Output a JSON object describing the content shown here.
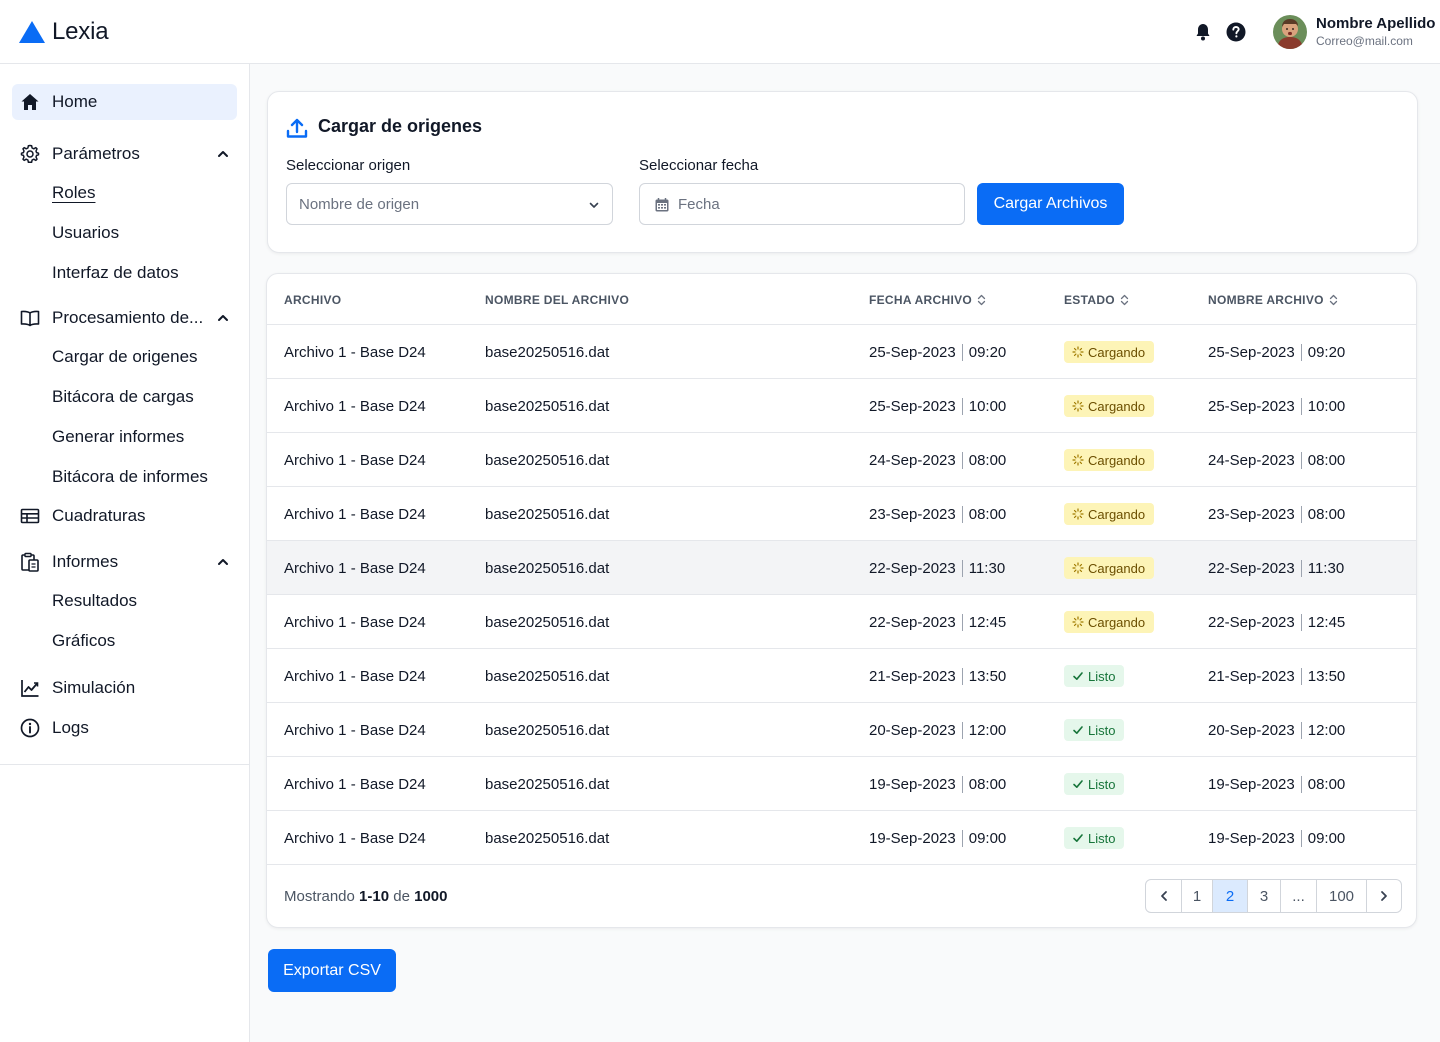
{
  "app": {
    "name": "Lexia"
  },
  "user": {
    "name": "Nombre Apellido",
    "email": "Correo@mail.com"
  },
  "sidebar": {
    "home": "Home",
    "parametros": {
      "label": "Parámetros",
      "children": [
        "Roles",
        "Usuarios",
        "Interfaz de datos"
      ]
    },
    "procesamiento": {
      "label": "Procesamiento de...",
      "children": [
        "Cargar de origenes",
        "Bitácora de cargas",
        "Generar informes",
        "Bitácora de informes"
      ]
    },
    "cuadraturas": "Cuadraturas",
    "informes": {
      "label": "Informes",
      "children": [
        "Resultados",
        "Gráficos"
      ]
    },
    "simulacion": "Simulación",
    "logs": "Logs"
  },
  "upload": {
    "title": "Cargar de origenes",
    "origin_label": "Seleccionar origen",
    "origin_placeholder": "Nombre de origen",
    "date_label": "Seleccionar fecha",
    "date_placeholder": "Fecha",
    "button": "Cargar Archivos"
  },
  "table": {
    "headers": [
      "ARCHIVO",
      "NOMBRE DEL ARCHIVO",
      "FECHA ARCHIVO",
      "ESTADO",
      "NOMBRE ARCHIVO"
    ],
    "rows": [
      {
        "archivo": "Archivo 1 - Base D24",
        "nombre": "base20250516.dat",
        "fecha": "25-Sep-2023",
        "hora": "09:20",
        "estado": "Cargando",
        "fecha2": "25-Sep-2023",
        "hora2": "09:20"
      },
      {
        "archivo": "Archivo 1 - Base D24",
        "nombre": "base20250516.dat",
        "fecha": "25-Sep-2023",
        "hora": "10:00",
        "estado": "Cargando",
        "fecha2": "25-Sep-2023",
        "hora2": "10:00"
      },
      {
        "archivo": "Archivo 1 - Base D24",
        "nombre": "base20250516.dat",
        "fecha": "24-Sep-2023",
        "hora": "08:00",
        "estado": "Cargando",
        "fecha2": "24-Sep-2023",
        "hora2": "08:00"
      },
      {
        "archivo": "Archivo 1 - Base D24",
        "nombre": "base20250516.dat",
        "fecha": "23-Sep-2023",
        "hora": "08:00",
        "estado": "Cargando",
        "fecha2": "23-Sep-2023",
        "hora2": "08:00"
      },
      {
        "archivo": "Archivo 1 - Base D24",
        "nombre": "base20250516.dat",
        "fecha": "22-Sep-2023",
        "hora": "11:30",
        "estado": "Cargando",
        "fecha2": "22-Sep-2023",
        "hora2": "11:30"
      },
      {
        "archivo": "Archivo 1 - Base D24",
        "nombre": "base20250516.dat",
        "fecha": "22-Sep-2023",
        "hora": "12:45",
        "estado": "Cargando",
        "fecha2": "22-Sep-2023",
        "hora2": "12:45"
      },
      {
        "archivo": "Archivo 1 - Base D24",
        "nombre": "base20250516.dat",
        "fecha": "21-Sep-2023",
        "hora": "13:50",
        "estado": "Listo",
        "fecha2": "21-Sep-2023",
        "hora2": "13:50"
      },
      {
        "archivo": "Archivo 1 - Base D24",
        "nombre": "base20250516.dat",
        "fecha": "20-Sep-2023",
        "hora": "12:00",
        "estado": "Listo",
        "fecha2": "20-Sep-2023",
        "hora2": "12:00"
      },
      {
        "archivo": "Archivo 1 - Base D24",
        "nombre": "base20250516.dat",
        "fecha": "19-Sep-2023",
        "hora": "08:00",
        "estado": "Listo",
        "fecha2": "19-Sep-2023",
        "hora2": "08:00"
      },
      {
        "archivo": "Archivo 1 - Base D24",
        "nombre": "base20250516.dat",
        "fecha": "19-Sep-2023",
        "hora": "09:00",
        "estado": "Listo",
        "fecha2": "19-Sep-2023",
        "hora2": "09:00"
      }
    ]
  },
  "footer": {
    "showing_prefix": "Mostrando",
    "range": "1-10",
    "of": "de",
    "total": "1000"
  },
  "pagination": {
    "pages": [
      "1",
      "2",
      "3",
      "...",
      "100"
    ],
    "current": "2"
  },
  "export_button": "Exportar CSV",
  "colors": {
    "accent": "#0a6cf5",
    "loading_badge": "#fdf4b7",
    "ready_badge": "#e5f7eb"
  }
}
